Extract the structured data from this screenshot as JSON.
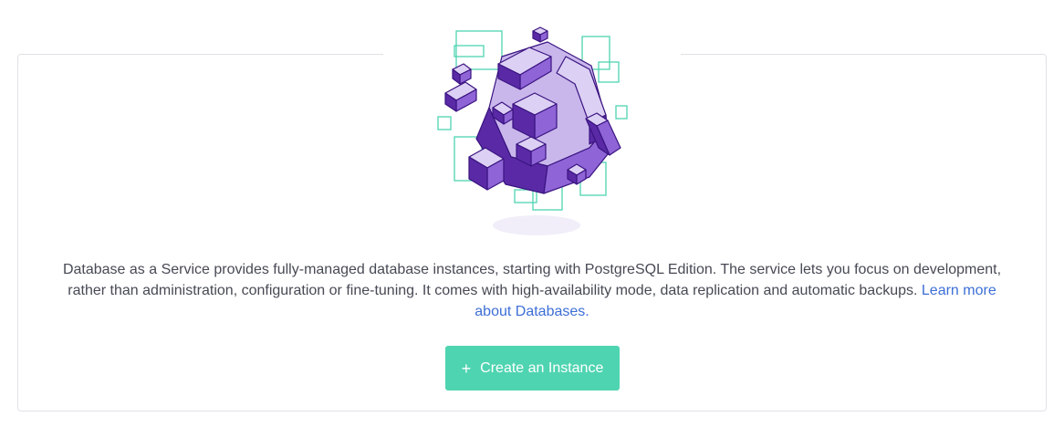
{
  "description": {
    "text": "Database as a Service provides fully-managed database instances, starting with PostgreSQL Edition. The service lets you focus on development, rather than administration, configuration or fine-tuning. It comes with high-availability mode, data replication and automatic backups. ",
    "link_text": "Learn more about Databases."
  },
  "create_button": {
    "icon": "plus-icon",
    "label": "Create an Instance"
  },
  "illustration": {
    "name": "database-cubes-illustration",
    "colors": {
      "primary": "#5a2aa6",
      "light": "#c9b7ec",
      "mid": "#8e64d6",
      "outline": "#4fd4b1",
      "shadow": "#f1eefa"
    }
  },
  "colors": {
    "accent": "#4fd4b1",
    "link": "#3d6fd6",
    "text": "#474a54",
    "border": "#dfe1e6"
  }
}
